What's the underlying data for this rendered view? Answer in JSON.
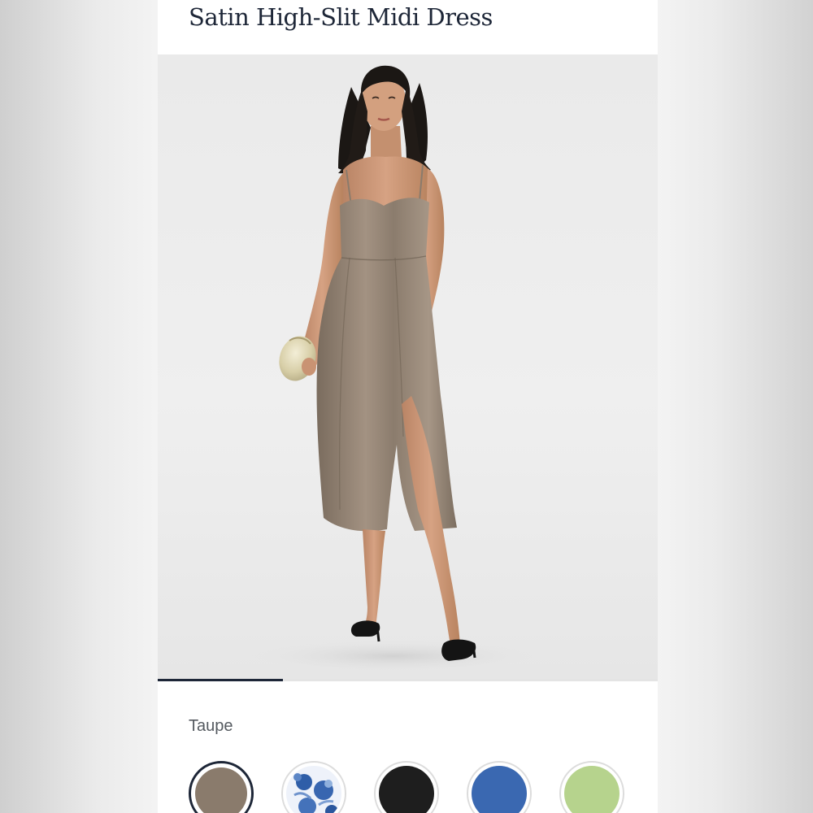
{
  "product": {
    "title": "Satin High-Slit Midi Dress"
  },
  "gallery": {
    "image_description": "model-wearing-taupe-satin-midi-dress",
    "progress": 0.25
  },
  "color_picker": {
    "selected_label": "Taupe",
    "swatches": [
      {
        "name": "taupe",
        "color": "#8a7b6c",
        "selected": true
      },
      {
        "name": "blue-floral",
        "color": "#2f5ea8",
        "selected": false
      },
      {
        "name": "black",
        "color": "#1e1e1e",
        "selected": false
      },
      {
        "name": "blue",
        "color": "#3a68b1",
        "selected": false
      },
      {
        "name": "light-green",
        "color": "#b6d38d",
        "selected": false
      }
    ]
  },
  "colors": {
    "ink": "#1d2637",
    "dress": "#8e7f70"
  }
}
